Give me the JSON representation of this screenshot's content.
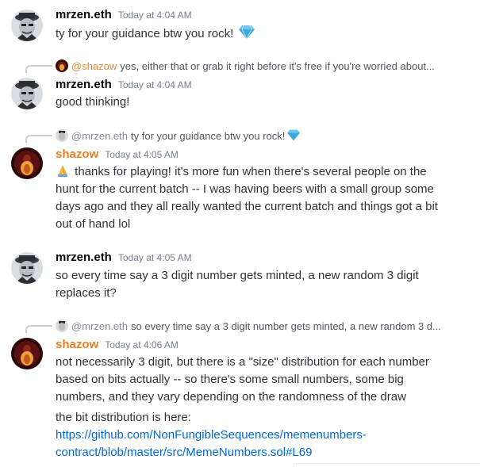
{
  "messages": [
    {
      "author": "mrzen.eth",
      "timestamp": "Today at 4:04 AM",
      "text": "ty for your guidance btw  you rock!",
      "emoji": "gem-stone-icon"
    },
    {
      "reply": {
        "name": "@shazow",
        "text": "yes, either that or grab it right before it's free if you're worried about..."
      },
      "author": "mrzen.eth",
      "timestamp": "Today at 4:04 AM",
      "text": "good thinking!"
    },
    {
      "reply": {
        "name": "@mrzen.eth",
        "text": "ty for your guidance btw  you rock!",
        "emoji": "gem-stone-icon"
      },
      "author": "shazow",
      "timestamp": "Today at 4:05 AM",
      "emoji_lead": "folded-hands-icon",
      "lines": [
        "thanks for playing! it's more fun when there's several people on the",
        "hunt for the current batch -- I was having beers with a small group some",
        "days ago and they all really wanted the current batch and things got a bit",
        "out of hand lol"
      ]
    },
    {
      "author": "mrzen.eth",
      "timestamp": "Today at 4:05 AM",
      "lines": [
        "so every time say a 3 digit number gets minted, a new random 3 digit",
        "replaces it?"
      ]
    },
    {
      "reply": {
        "name": "@mrzen.eth",
        "text": "so every time say a 3 digit number gets minted, a new random 3 d..."
      },
      "author": "shazow",
      "timestamp": "Today at 4:06 AM",
      "lines": [
        "not necessarily 3 digit, but there is a \"size\" distribution for each number",
        "based on bits actually -- so there's some small numbers, some big",
        "numbers, and they vary depending on the randomness of the draw"
      ],
      "followup": "the bit distribution is here:",
      "link_lines": [
        "https://github.com/NonFungibleSequences/memenumbers-",
        "contract/blob/master/src/MemeNumbers.sol#L69"
      ]
    }
  ],
  "colors": {
    "shazow_name": "#e67e22",
    "link": "#0068e0",
    "timestamp": "#747f8d",
    "text": "#2e3338"
  }
}
